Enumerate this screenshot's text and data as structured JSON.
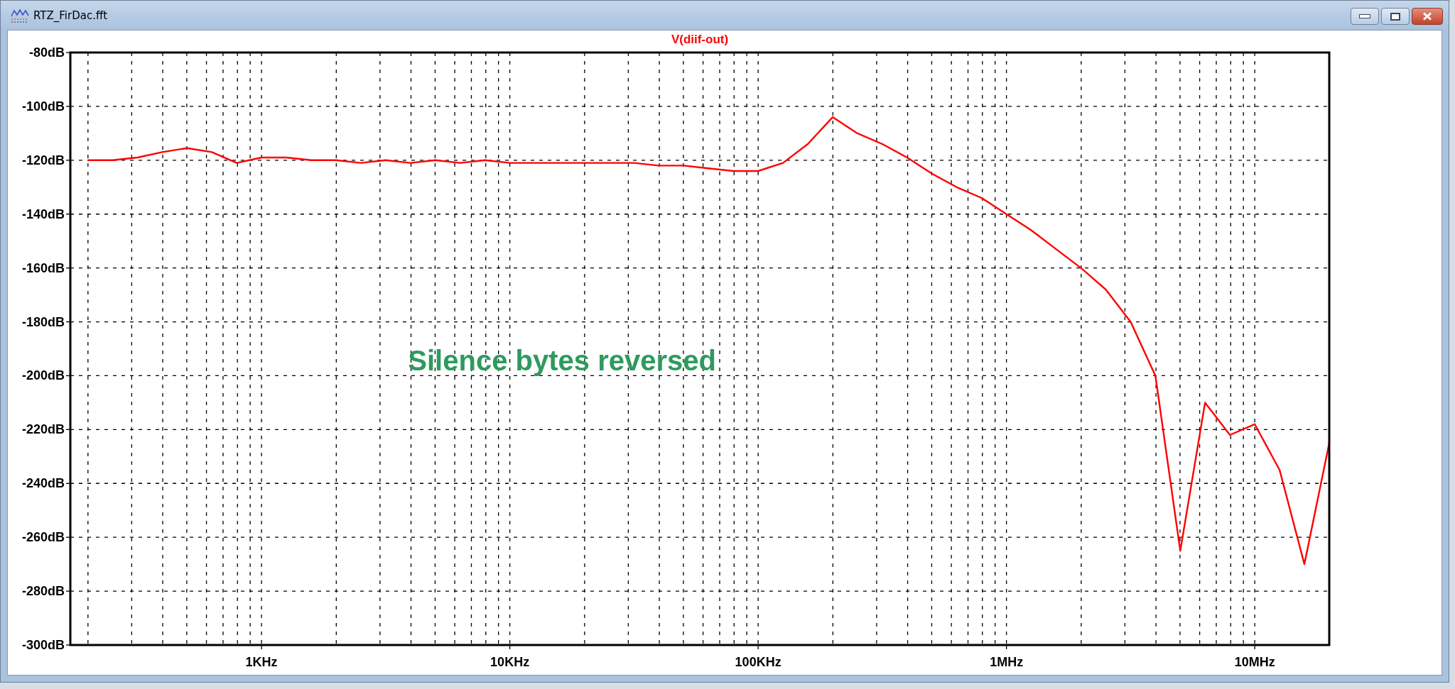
{
  "window": {
    "title": "RTZ_FirDac.fft"
  },
  "plot": {
    "chart_data": {
      "type": "line",
      "grid": true,
      "ylim": [
        -300,
        -80
      ],
      "yticks": [
        {
          "value": -80,
          "label": "-80dB"
        },
        {
          "value": -100,
          "label": "-100dB"
        },
        {
          "value": -120,
          "label": "-120dB"
        },
        {
          "value": -140,
          "label": "-140dB"
        },
        {
          "value": -160,
          "label": "-160dB"
        },
        {
          "value": -180,
          "label": "-180dB"
        },
        {
          "value": -200,
          "label": "-200dB"
        },
        {
          "value": -220,
          "label": "-220dB"
        },
        {
          "value": -240,
          "label": "-240dB"
        },
        {
          "value": -260,
          "label": "-260dB"
        },
        {
          "value": -280,
          "label": "-280dB"
        },
        {
          "value": -300,
          "label": "-300dB"
        }
      ],
      "categories": [
        null,
        null,
        null,
        null,
        null,
        null,
        null,
        "1KHz",
        null,
        null,
        null,
        null,
        null,
        null,
        null,
        null,
        null,
        "10KHz",
        null,
        null,
        null,
        null,
        null,
        null,
        null,
        null,
        null,
        "100KHz",
        null,
        null,
        null,
        null,
        null,
        null,
        null,
        null,
        null,
        "1MHz",
        null,
        null,
        null,
        null,
        null,
        null,
        null,
        null,
        null,
        "10MHz",
        null,
        null,
        null
      ],
      "series": [
        {
          "name": "V(diif-out)",
          "color": "#ff0000",
          "values": [
            -120,
            -120,
            -119,
            -117,
            -115.5,
            -117,
            -121,
            -119,
            -119,
            -120,
            -120,
            -121,
            -120,
            -121,
            -120,
            -121,
            -120,
            -121,
            -121,
            -121,
            -121,
            -121,
            -121,
            -122,
            -122,
            -123,
            -124,
            -124,
            -121,
            -114,
            -104,
            -110,
            -114,
            -119,
            -125,
            -130,
            -134,
            -140,
            -146,
            -153,
            -160,
            -168,
            -180,
            -200,
            -265,
            -210,
            -222,
            -218,
            -235,
            -270,
            -225
          ]
        }
      ],
      "annotations": [
        "Silence bytes reversed"
      ]
    }
  }
}
